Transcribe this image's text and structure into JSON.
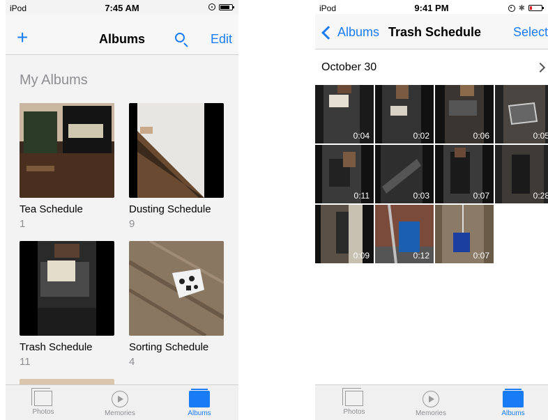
{
  "left": {
    "status": {
      "carrier": "iPod",
      "time": "7:45 AM"
    },
    "nav": {
      "title": "Albums",
      "edit": "Edit",
      "add": "+"
    },
    "section": "My Albums",
    "albums": [
      {
        "name": "Tea Schedule",
        "count": "1"
      },
      {
        "name": "Dusting Schedule",
        "count": "9"
      },
      {
        "name": "Trash Schedule",
        "count": "11"
      },
      {
        "name": "Sorting Schedule",
        "count": "4"
      }
    ],
    "tabs": [
      {
        "label": "Photos"
      },
      {
        "label": "Memories"
      },
      {
        "label": "Albums"
      }
    ]
  },
  "right": {
    "status": {
      "carrier": "iPod",
      "time": "9:41 PM"
    },
    "nav": {
      "back": "Albums",
      "title": "Trash Schedule",
      "select": "Select"
    },
    "date": "October 30",
    "videos": [
      {
        "duration": "0:04"
      },
      {
        "duration": "0:02"
      },
      {
        "duration": "0:06"
      },
      {
        "duration": "0:05"
      },
      {
        "duration": "0:11"
      },
      {
        "duration": "0:03"
      },
      {
        "duration": "0:07"
      },
      {
        "duration": "0:28"
      },
      {
        "duration": "0:09"
      },
      {
        "duration": "0:12"
      },
      {
        "duration": "0:07"
      }
    ],
    "tabs": [
      {
        "label": "Photos"
      },
      {
        "label": "Memories"
      },
      {
        "label": "Albums"
      }
    ]
  },
  "colors": {
    "accent": "#1a7cf5",
    "secondary_text": "#8e8e93",
    "low_battery": "#e02020"
  }
}
